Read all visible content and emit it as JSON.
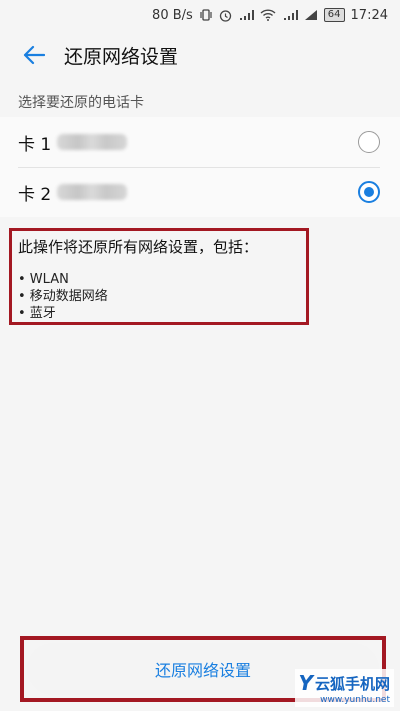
{
  "status_bar": {
    "speed": "80 B/s",
    "battery": "64",
    "time": "17:24"
  },
  "header": {
    "title": "还原网络设置"
  },
  "sim_section": {
    "label": "选择要还原的电话卡",
    "cards": [
      {
        "label": "卡 1",
        "selected": false
      },
      {
        "label": "卡 2",
        "selected": true
      }
    ]
  },
  "info": {
    "title": "此操作将还原所有网络设置，包括：",
    "items": [
      "• WLAN",
      "• 移动数据网络",
      "• 蓝牙"
    ]
  },
  "action": {
    "reset_label": "还原网络设置"
  },
  "watermark": {
    "brand": "云狐手机网",
    "url": "www.yunhu.net"
  },
  "colors": {
    "accent": "#1a7fe0",
    "highlight": "#a31822"
  }
}
